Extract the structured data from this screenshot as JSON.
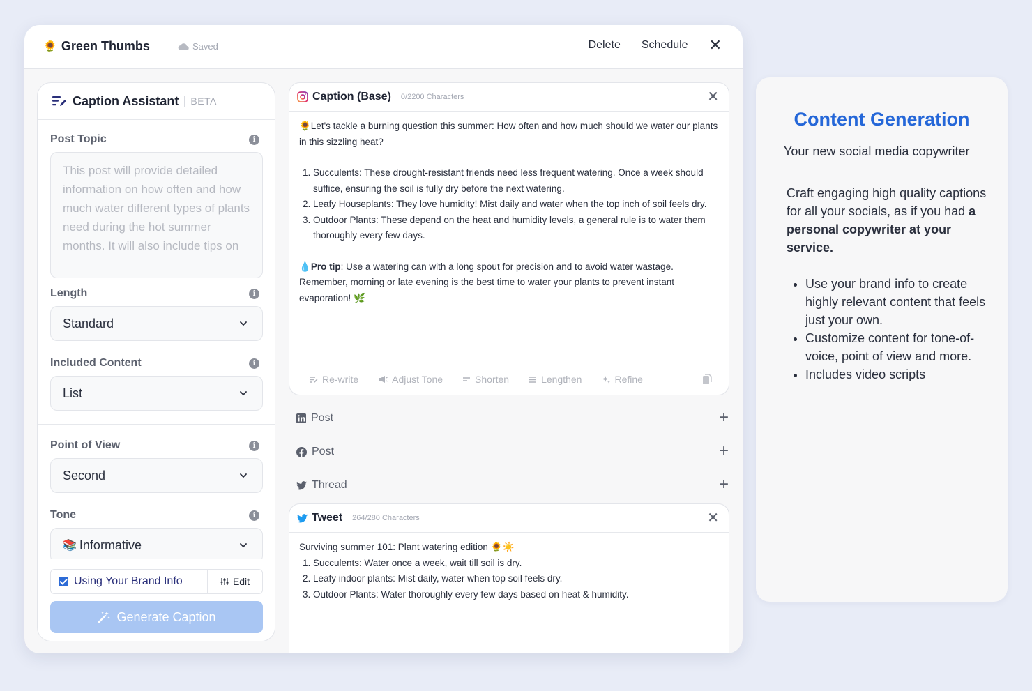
{
  "topbar": {
    "brand_emoji": "🌻",
    "brand_name": "Green Thumbs",
    "saved_label": "Saved",
    "delete_label": "Delete",
    "schedule_label": "Schedule",
    "close_label": "✕"
  },
  "assistant": {
    "title": "Caption Assistant",
    "badge": "BETA",
    "post_topic_label": "Post Topic",
    "post_topic_placeholder": "This post will provide detailed information on how often and how much water different types of plants need during the hot summer months. It will also include tips on",
    "length_label": "Length",
    "length_value": "Standard",
    "included_label": "Included Content",
    "included_value": "List",
    "pov_label": "Point of View",
    "pov_value": "Second",
    "tone_label": "Tone",
    "tone_emoji": "📚",
    "tone_value": "Informative",
    "brand_info_label": "Using Your Brand Info",
    "edit_label": "Edit",
    "generate_label": "Generate Caption"
  },
  "caption_card": {
    "title": "Caption (Base)",
    "count": "0/2200 Characters",
    "intro": "🌻Let's tackle a burning question this summer: How often and how much should we water our plants in this sizzling heat?",
    "items": [
      "Succulents: These drought-resistant friends need less frequent watering. Once a week should suffice, ensuring the soil is fully dry before the next watering.",
      "Leafy Houseplants: They love humidity! Mist daily and water when the top inch of soil feels dry.",
      "Outdoor Plants: These depend on the heat and humidity levels, a general rule is to water them thoroughly every few days."
    ],
    "tip_emoji": "💧",
    "tip_label": "Pro tip",
    "tip_text": ": Use a watering can with a long spout for precision and to avoid water wastage. Remember, morning or late evening is the best time to water your plants to prevent instant evaporation! 🌿",
    "tools": [
      "Re-write",
      "Adjust Tone",
      "Shorten",
      "Lengthen",
      "Refine"
    ]
  },
  "platform_rows": [
    {
      "icon": "linkedin-icon",
      "label": "Post"
    },
    {
      "icon": "facebook-icon",
      "label": "Post"
    },
    {
      "icon": "twitter-icon",
      "label": "Thread"
    }
  ],
  "tweet_card": {
    "title": "Tweet",
    "count": "264/280 Characters",
    "intro": "Surviving summer 101: Plant watering edition 🌻☀️",
    "items": [
      "Succulents: Water once a week, wait till soil is dry.",
      "Leafy indoor plants: Mist daily, water when top soil feels dry.",
      "Outdoor Plants: Water thoroughly every few days based on heat & humidity."
    ]
  },
  "info_card": {
    "heading": "Content Generation",
    "subheading": "Your new social media copywriter",
    "para_start": "Craft engaging high quality captions for all your socials, as if you had ",
    "para_bold": "a personal copywriter at your service.",
    "bullets": [
      "Use your brand info to create highly relevant content that feels just your own.",
      "Customize content for tone-of-voice, point of view and more.",
      "Includes video scripts"
    ]
  },
  "colors": {
    "accent": "#2567d8",
    "generate_button": "#a9c6f3",
    "background": "#e8ecf7"
  }
}
